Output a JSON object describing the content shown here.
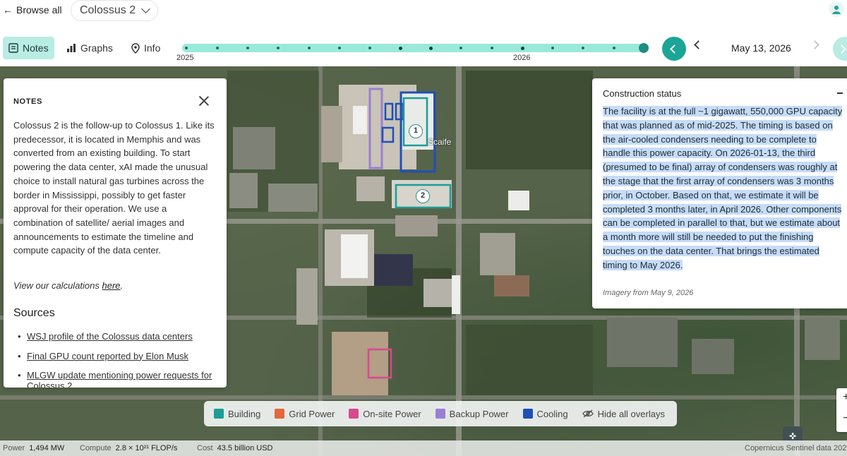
{
  "header": {
    "browse_label": "Browse all",
    "site_name": "Colossus 2"
  },
  "tabs": [
    {
      "label": "Notes",
      "icon": "notes-icon",
      "active": true
    },
    {
      "label": "Graphs",
      "icon": "bar-chart-icon",
      "active": false
    },
    {
      "label": "Info",
      "icon": "location-pin-icon",
      "active": false
    }
  ],
  "timeline": {
    "start_label": "2025",
    "mid_label": "2026",
    "date": "May 13, 2026"
  },
  "notes": {
    "heading": "NOTES",
    "body": "Colossus 2 is the follow-up to Colossus 1. Like its predecessor, it is located in Memphis and was converted from an existing building. To start powering the data center, xAI made the unusual choice to install natural gas turbines across the border in Mississippi, possibly to get faster approval for their operation. We use a combination of satellite/ aerial images and announcements to estimate the timeline and compute capacity of the data center.",
    "calc_prefix": "View our calculations ",
    "calc_link": "here",
    "calc_suffix": ".",
    "sources_heading": "Sources",
    "sources": [
      "WSJ profile of the Colossus data centers",
      "Final GPU count reported by Elon Musk",
      "MLGW update mentioning power requests for Colossus 2"
    ]
  },
  "status": {
    "title": "Construction status",
    "text": "The facility is at the full ~1 gigawatt, 550,000 GPU capacity that was planned as of mid-2025. The timing is based on the air-cooled condensers needing to be complete to handle this power capacity. On 2026-01-13, the third (presumed to be final) array of condensers was roughly at the stage that the first array of condensers was 3 months prior, in October. Based on that, we estimate it will be completed 3 months later, in April 2026. Other components can be completed in parallel to that, but we estimate about a month more will still be needed to put the finishing touches on the data center. That brings the estimated timing to May 2026.",
    "imagery": "Imagery from May 9, 2026"
  },
  "map": {
    "street_label": "Scaife",
    "markers": [
      "1",
      "2"
    ]
  },
  "legend": [
    {
      "label": "Building",
      "color": "#1a9e97"
    },
    {
      "label": "Grid Power",
      "color": "#e06a3a"
    },
    {
      "label": "On-site Power",
      "color": "#d9488f"
    },
    {
      "label": "Backup Power",
      "color": "#9b7fd6"
    },
    {
      "label": "Cooling",
      "color": "#1f4fb8"
    }
  ],
  "legend_hide_label": "Hide all overlays",
  "footer": {
    "power_label": "Power",
    "power_value": "1,494 MW",
    "compute_label": "Compute",
    "compute_value": "2.8 × 10²¹ FLOP/s",
    "cost_label": "Cost",
    "cost_value": "43.5 billion USD",
    "credit": "Copernicus Sentinel data 202"
  },
  "colors": {
    "accent": "#1ba597",
    "timeline_track": "#9ae9d9",
    "active_tab": "#b9ece3",
    "highlight": "#c7dcf7"
  }
}
